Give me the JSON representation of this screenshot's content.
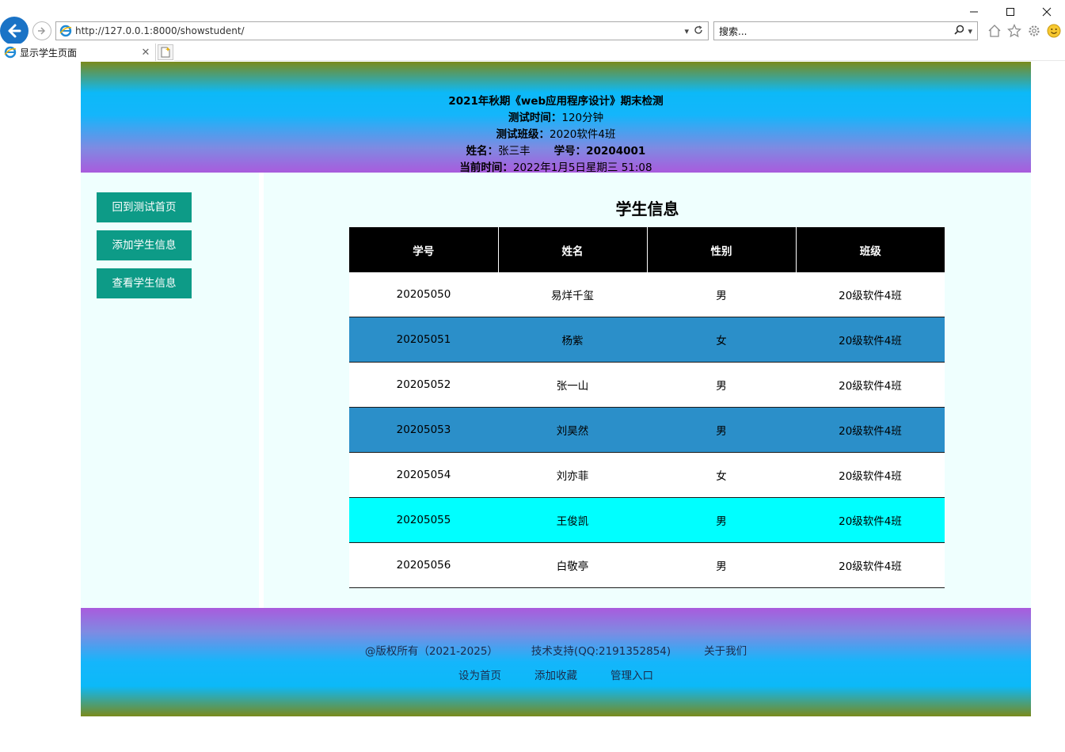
{
  "browser": {
    "address": "http://127.0.0.1:8000/showstudent/",
    "search_placeholder": "搜索...",
    "tab_title": "显示学生页面"
  },
  "header": {
    "title": "2021年秋期《web应用程序设计》期末检测",
    "duration_label": "测试时间：",
    "duration_value": "120分钟",
    "class_label": "测试班级：",
    "class_value": "2020软件4班",
    "name_label": "姓名：",
    "name_value": "张三丰",
    "id_label": "学号：",
    "id_value": "20204001",
    "time_label": "当前时间：",
    "time_value": "2022年1月5日星期三 51:08"
  },
  "sidebar": {
    "items": [
      {
        "label": "回到测试首页"
      },
      {
        "label": "添加学生信息"
      },
      {
        "label": "查看学生信息"
      }
    ]
  },
  "main": {
    "title": "学生信息",
    "columns": [
      "学号",
      "姓名",
      "性别",
      "班级"
    ],
    "rows": [
      {
        "id": "20205050",
        "name": "易烊千玺",
        "gender": "男",
        "class": "20级软件4班"
      },
      {
        "id": "20205051",
        "name": "杨紫",
        "gender": "女",
        "class": "20级软件4班"
      },
      {
        "id": "20205052",
        "name": "张一山",
        "gender": "男",
        "class": "20级软件4班"
      },
      {
        "id": "20205053",
        "name": "刘昊然",
        "gender": "男",
        "class": "20级软件4班"
      },
      {
        "id": "20205054",
        "name": "刘亦菲",
        "gender": "女",
        "class": "20级软件4班"
      },
      {
        "id": "20205055",
        "name": "王俊凯",
        "gender": "男",
        "class": "20级软件4班"
      },
      {
        "id": "20205056",
        "name": "白敬亭",
        "gender": "男",
        "class": "20级软件4班"
      }
    ]
  },
  "footer": {
    "copyright": "@版权所有（2021-2025）",
    "support": "技术支持(QQ:2191352854)",
    "about": "关于我们",
    "set_home": "设为首页",
    "add_fav": "添加收藏",
    "admin": "管理入口"
  },
  "colors": {
    "row_blue": "#2b8fc9",
    "row_cyan": "#00ffff",
    "button_teal": "#0d9b87",
    "panel_bg": "#effffe"
  }
}
